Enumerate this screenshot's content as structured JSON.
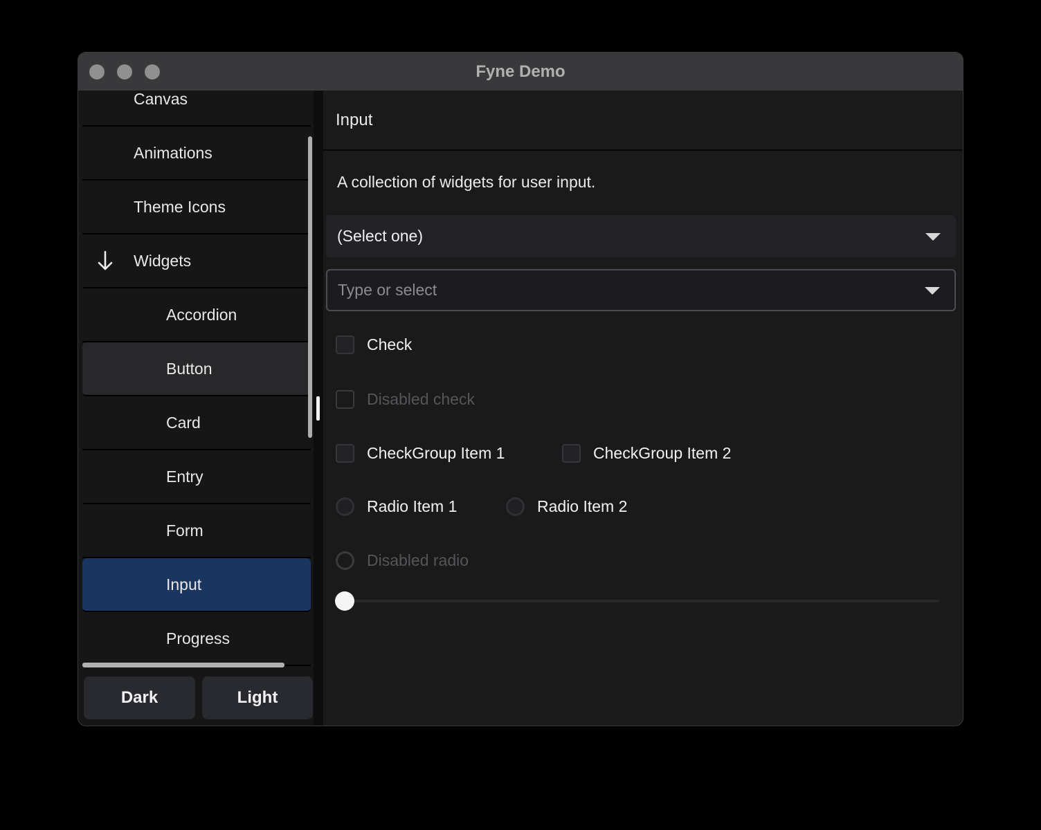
{
  "window": {
    "title": "Fyne Demo"
  },
  "colors": {
    "accent": "#1a3560",
    "titlebar": "#39393b",
    "window_bg": "#1a1a1a",
    "sidebar_bg": "#161616",
    "hover_row": "#28282a",
    "widget_bg": "#232227",
    "entry_border": "#4c4c52",
    "scrollbar": "#adadad",
    "disabled_text": "#55555a",
    "dim_title": "#b0b0b0"
  },
  "sidebar": {
    "items": [
      {
        "label": "Canvas",
        "level": 1,
        "state": "normal"
      },
      {
        "label": "Animations",
        "level": 1,
        "state": "normal"
      },
      {
        "label": "Theme Icons",
        "level": 1,
        "state": "normal"
      },
      {
        "label": "Widgets",
        "level": 1,
        "state": "expanded",
        "icon": "arrow-down-icon"
      },
      {
        "label": "Accordion",
        "level": 2,
        "state": "normal"
      },
      {
        "label": "Button",
        "level": 2,
        "state": "hover"
      },
      {
        "label": "Card",
        "level": 2,
        "state": "normal"
      },
      {
        "label": "Entry",
        "level": 2,
        "state": "normal"
      },
      {
        "label": "Form",
        "level": 2,
        "state": "normal"
      },
      {
        "label": "Input",
        "level": 2,
        "state": "selected"
      },
      {
        "label": "Progress",
        "level": 2,
        "state": "normal"
      }
    ],
    "theme_buttons": {
      "dark": "Dark",
      "light": "Light"
    }
  },
  "content": {
    "title": "Input",
    "description": "A collection of widgets for user input.",
    "select": {
      "value": "(Select one)",
      "icon": "chevron-down-icon"
    },
    "combo": {
      "placeholder": "Type or select",
      "icon": "chevron-down-icon"
    },
    "check": {
      "label": "Check",
      "checked": false
    },
    "disabled_check": {
      "label": "Disabled check",
      "checked": false
    },
    "check_group": [
      {
        "label": "CheckGroup Item 1",
        "checked": false
      },
      {
        "label": "CheckGroup Item 2",
        "checked": false
      }
    ],
    "radio_group": [
      {
        "label": "Radio Item 1",
        "selected": false
      },
      {
        "label": "Radio Item 2",
        "selected": false
      }
    ],
    "disabled_radio": {
      "label": "Disabled radio",
      "selected": false
    },
    "slider": {
      "value": 0
    }
  }
}
